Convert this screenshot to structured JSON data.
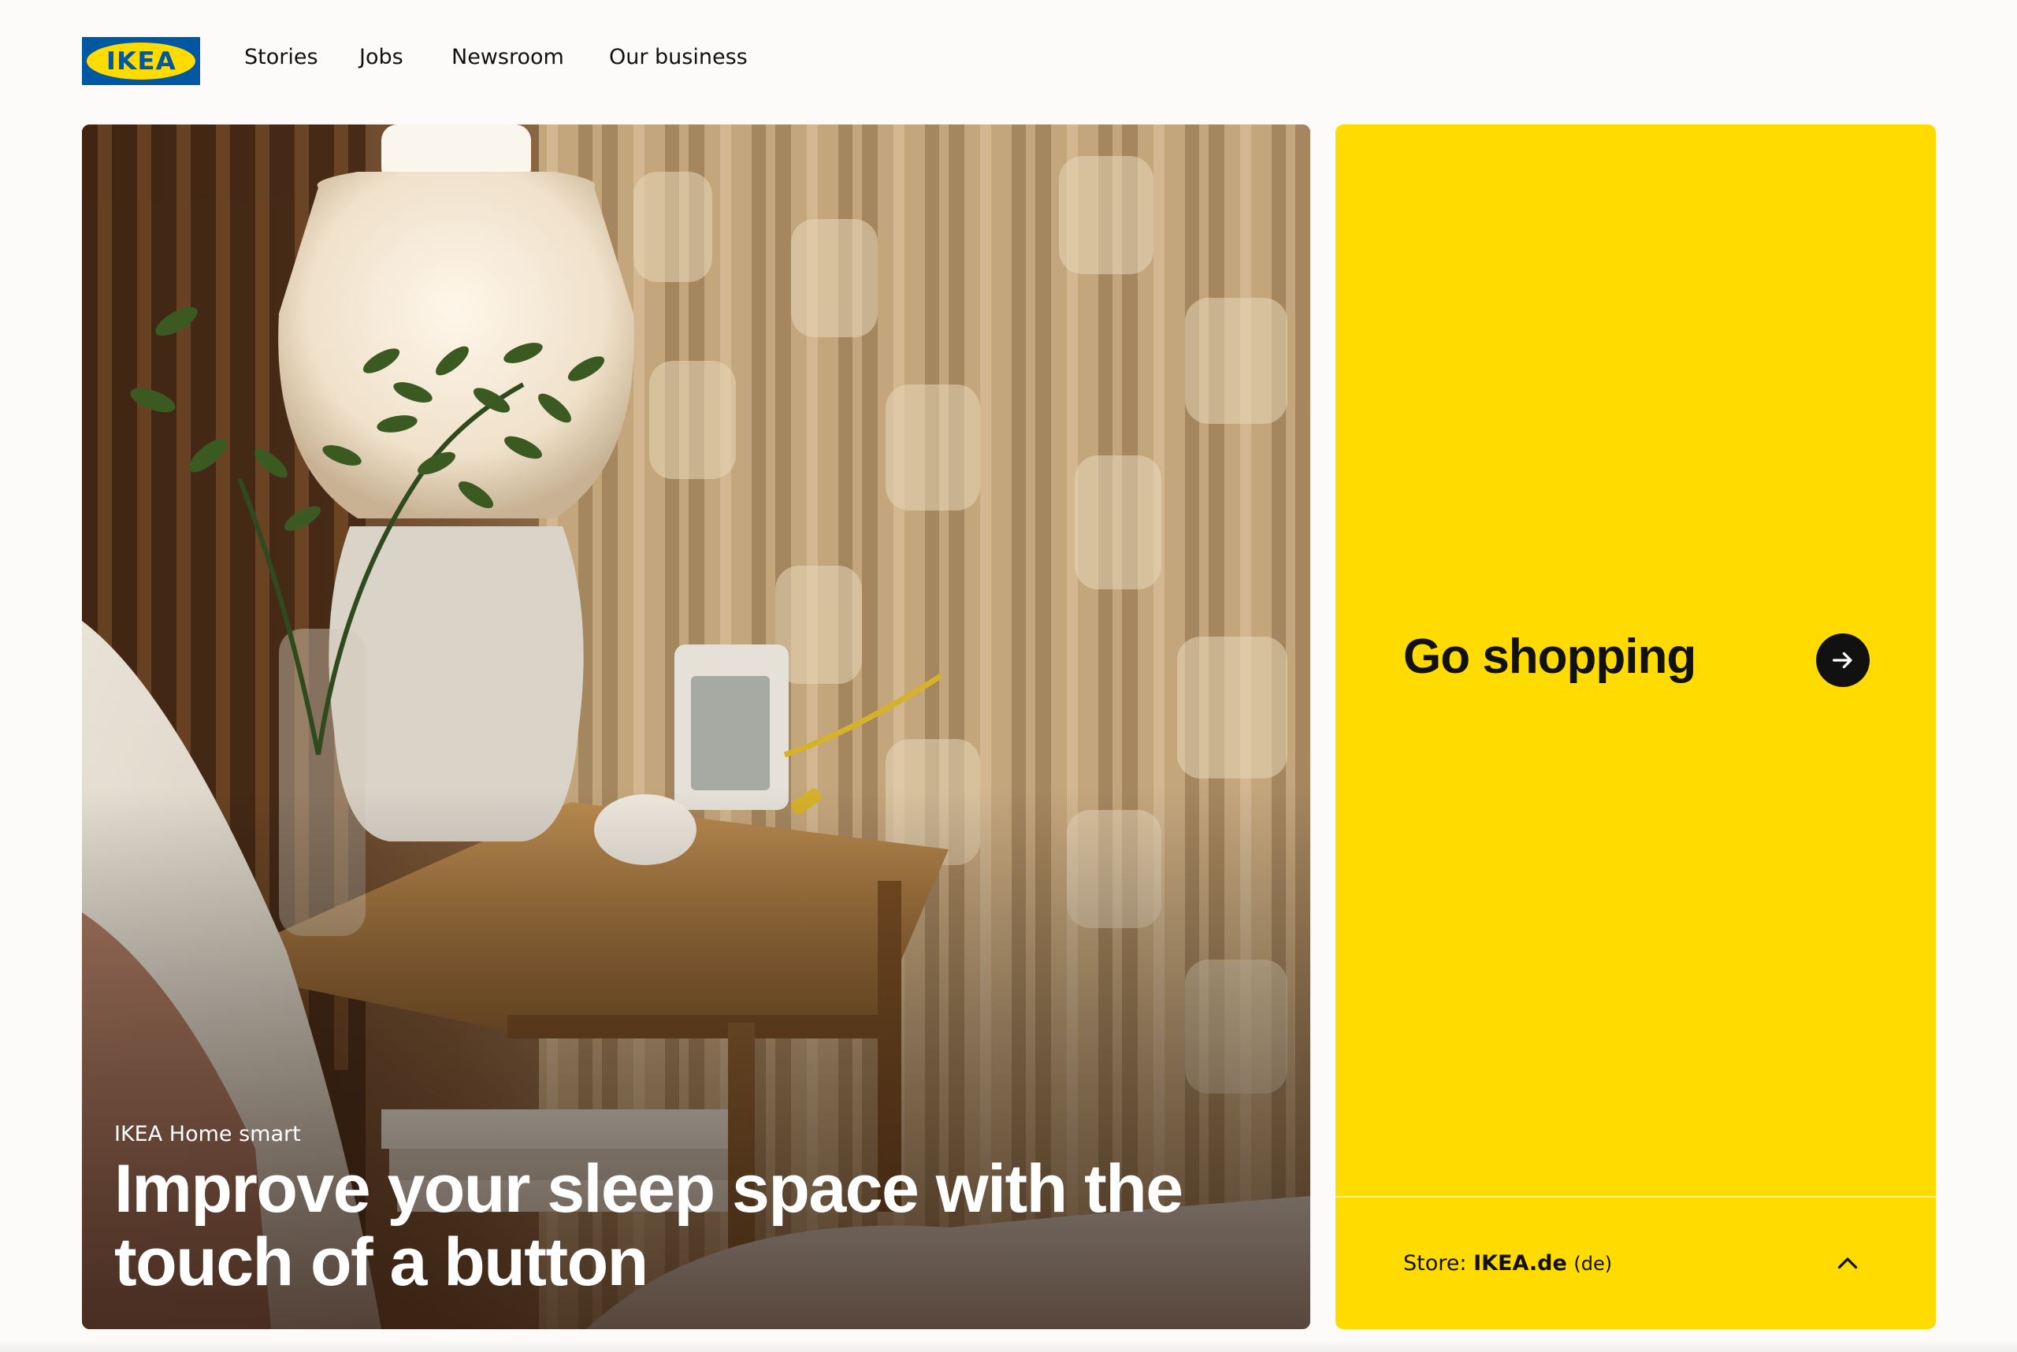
{
  "brand": {
    "logo_text": "IKEA",
    "colors": {
      "blue": "#0058a3",
      "yellow": "#ffdb00"
    }
  },
  "nav": {
    "items": [
      {
        "label": "Stories"
      },
      {
        "label": "Jobs"
      },
      {
        "label": "Newsroom"
      },
      {
        "label": "Our business"
      }
    ]
  },
  "hero": {
    "eyebrow": "IKEA Home smart",
    "headline": "Improve your sleep space with the touch of a button"
  },
  "shop": {
    "go_label": "Go shopping",
    "go_icon": "arrow-right-icon",
    "store_prefix": "Store:",
    "store_name": "IKEA.de",
    "store_lang": "(de)",
    "toggle_icon": "chevron-up-icon"
  }
}
